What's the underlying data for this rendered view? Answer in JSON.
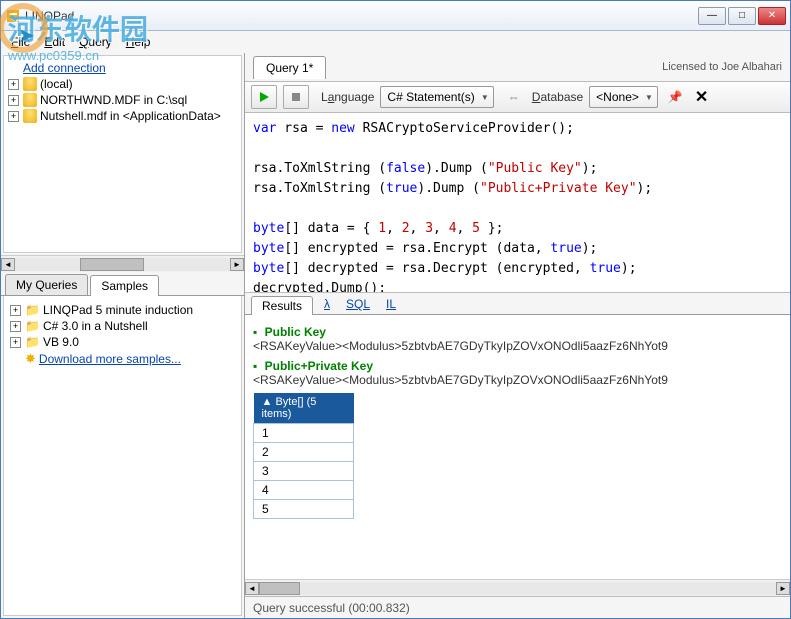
{
  "title": "LINQPad",
  "license": "Licensed to Joe Albahari",
  "menu": {
    "file": "File",
    "edit": "Edit",
    "query": "Query",
    "help": "Help"
  },
  "watermark": {
    "text": "河东软件园",
    "url": "www.pc0359.cn"
  },
  "sidebar": {
    "add_connection": "Add connection",
    "connections": [
      "(local)",
      "NORTHWND.MDF in C:\\sql",
      "Nutshell.mdf in <ApplicationData>"
    ]
  },
  "tabs": {
    "myqueries": "My Queries",
    "samples": "Samples"
  },
  "samples": {
    "items": [
      "LINQPad 5 minute induction",
      "C# 3.0 in a Nutshell",
      "VB 9.0"
    ],
    "download": "Download more samples..."
  },
  "query_tab": "Query 1*",
  "toolbar": {
    "language_label": "Language",
    "language_value": "C# Statement(s)",
    "database_label": "Database",
    "database_value": "<None>"
  },
  "code": {
    "l1a": "var",
    "l1b": " rsa = ",
    "l1c": "new",
    "l1d": " RSACryptoServiceProvider();",
    "l2a": "rsa.ToXmlString (",
    "l2b": "false",
    "l2c": ").Dump (",
    "l2d": "\"Public Key\"",
    "l2e": ");",
    "l3a": "rsa.ToXmlString (",
    "l3b": "true",
    "l3c": ").Dump (",
    "l3d": "\"Public+Private Key\"",
    "l3e": ");",
    "l4a": "byte",
    "l4b": "[] data = { ",
    "l4n1": "1",
    "l4n2": "2",
    "l4n3": "3",
    "l4n4": "4",
    "l4n5": "5",
    "l4c": " };",
    "l5a": "byte",
    "l5b": "[] encrypted = rsa.Encrypt (data, ",
    "l5c": "true",
    "l5d": ");",
    "l6a": "byte",
    "l6b": "[] decrypted = rsa.Decrypt (encrypted, ",
    "l6c": "true",
    "l6d": ");",
    "l7": "decrypted.Dump();"
  },
  "result_tabs": {
    "results": "Results",
    "lambda": "λ",
    "sql": "SQL",
    "il": "IL"
  },
  "results": {
    "h1": "Public Key",
    "xml1": "<RSAKeyValue><Modulus>5zbtvbAE7GDyTkyIpZOVxONOdli5aazFz6NhYot9",
    "h2": "Public+Private Key",
    "xml2": "<RSAKeyValue><Modulus>5zbtvbAE7GDyTkyIpZOVxONOdli5aazFz6NhYot9",
    "table_header": "▲ Byte[] (5 items)",
    "bytes": [
      "1",
      "2",
      "3",
      "4",
      "5"
    ]
  },
  "status": "Query successful  (00:00.832)"
}
